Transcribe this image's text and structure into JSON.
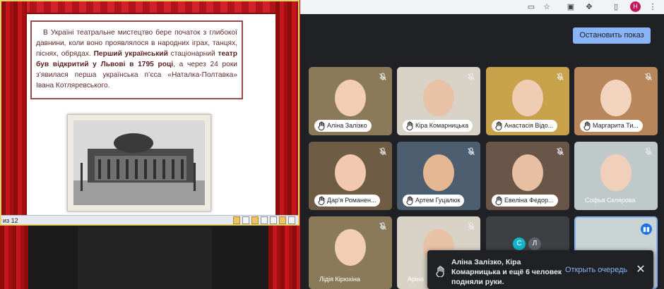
{
  "slide": {
    "text_lead": "В Україні театральне мистецтво бере початок з глибокої давнини, коли воно проявлялося в народних іграх, танцях, піснях, обрядах.",
    "text_bold1": "Перший український",
    "text_mid": "стаціонарний",
    "text_bold2": "театр був відкритий у Львові в 1795 році",
    "text_tail": ", а через 24 роки з’явилася перша українська п’єса «Наталка-Полтавка» Івана Котляревського.",
    "status_page": "из 12"
  },
  "meet": {
    "stop_button_label": "Остановить показ",
    "profile_initial": "Н",
    "participants": [
      {
        "name": "Аліна Залізко",
        "hand_raised": true,
        "muted": true
      },
      {
        "name": "Кіра Комарницька",
        "hand_raised": true,
        "muted": true
      },
      {
        "name": "Анастасія Відо...",
        "hand_raised": true,
        "muted": true
      },
      {
        "name": "Маргарита Ти...",
        "hand_raised": true,
        "muted": true
      },
      {
        "name": "Дар'я Романен...",
        "hand_raised": true,
        "muted": true
      },
      {
        "name": "Артем Гуцалюк",
        "hand_raised": true,
        "muted": true
      },
      {
        "name": "Евеліна Федор...",
        "hand_raised": true,
        "muted": true
      },
      {
        "name": "Софья Склярова",
        "hand_raised": false,
        "muted": true
      },
      {
        "name": "Лідія Кірюхіна",
        "hand_raised": false,
        "muted": true
      },
      {
        "name": "Аріна",
        "hand_raised": false,
        "muted": true
      }
    ],
    "avatars": [
      {
        "initial": "С",
        "color": "#12b5cb"
      },
      {
        "initial": "Л",
        "color": "#5f6368"
      }
    ],
    "toast": {
      "message": "Аліна Залізко, Кіра Комарницька и ещё 6 человек подняли руки.",
      "open_queue_label": "Открыть очередь",
      "close_label": "✕"
    }
  },
  "colors": {
    "accent": "#8ab4f8",
    "meet_bg": "#202124",
    "curtain_red": "#c4161c"
  }
}
